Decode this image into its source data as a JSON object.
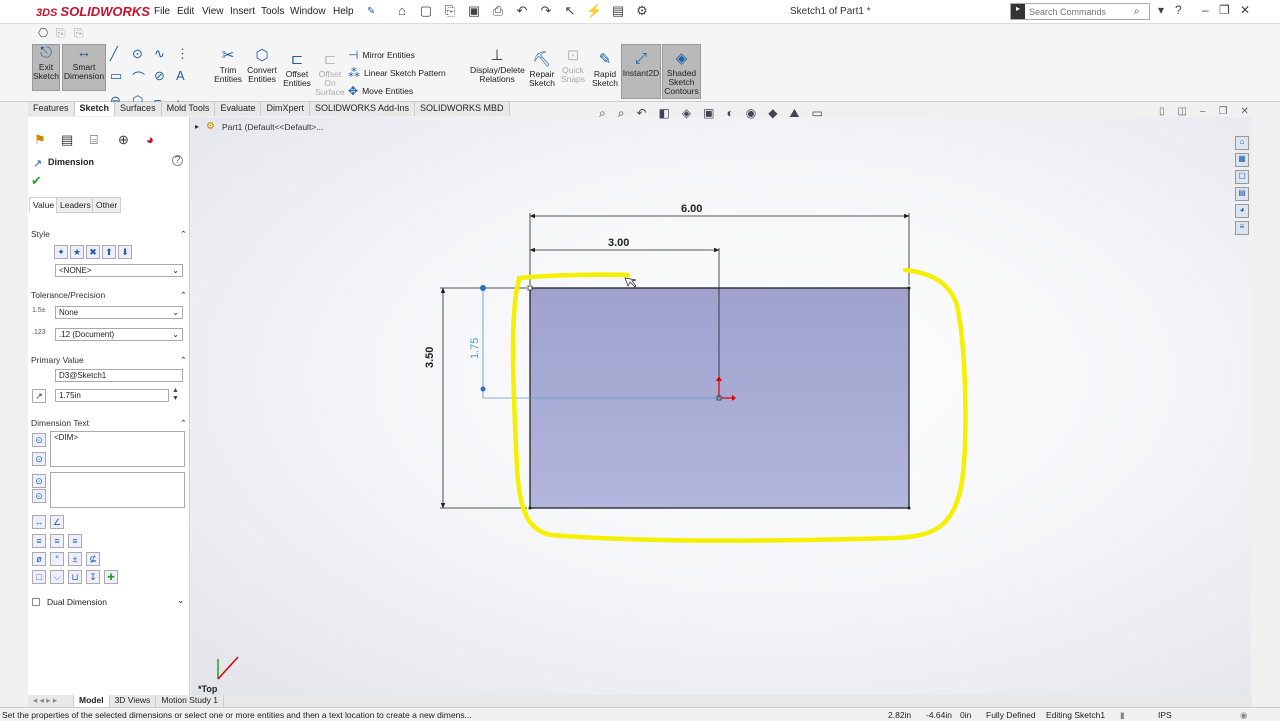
{
  "app": {
    "logo": "SOLIDWORKS",
    "doc_title": "Sketch1 of Part1 *"
  },
  "menu": [
    "File",
    "Edit",
    "View",
    "Insert",
    "Tools",
    "Window",
    "Help"
  ],
  "search": {
    "placeholder": "Search Commands"
  },
  "ribbon": {
    "exit_sketch": "Exit Sketch",
    "smart_dimension": "Smart Dimension",
    "trim": "Trim Entities",
    "convert": "Convert Entities",
    "offset": "Offset Entities",
    "offset_surface": "Offset On Surface",
    "mirror": "Mirror Entities",
    "linear_pattern": "Linear Sketch Pattern",
    "move": "Move Entities",
    "display_delete": "Display/Delete Relations",
    "repair": "Repair Sketch",
    "quick_snaps": "Quick Snaps",
    "rapid": "Rapid Sketch",
    "instant2d": "Instant2D",
    "shaded": "Shaded Sketch Contours"
  },
  "tabs": [
    "Features",
    "Sketch",
    "Surfaces",
    "Mold Tools",
    "Evaluate",
    "DimXpert",
    "SOLIDWORKS Add-Ins",
    "SOLIDWORKS MBD"
  ],
  "active_tab": "Sketch",
  "panel": {
    "title": "Dimension",
    "subtabs": [
      "Value",
      "Leaders",
      "Other"
    ],
    "style_label": "Style",
    "style_value": "<NONE>",
    "tolerance_label": "Tolerance/Precision",
    "tolerance_value": "None",
    "precision_value": ".12 (Document)",
    "primary_label": "Primary Value",
    "primary_name": "D3@Sketch1",
    "primary_value": "1.75in",
    "dimtext_label": "Dimension Text",
    "dimtext_value": "<DIM>",
    "dual_label": "Dual Dimension"
  },
  "tree": {
    "root": "Part1  (Default<<Default>..."
  },
  "sketch": {
    "dim_top": "6.00",
    "dim_mid": "3.00",
    "dim_left": "3.50",
    "dim_active": "1.75",
    "view_label": "*Top"
  },
  "colors": {
    "rect_fill": "#a3a6cf",
    "highlight": "#f5f000",
    "active_dim": "#5b9bd5",
    "brand": "#c8102e"
  },
  "bottom_tabs": [
    "Model",
    "3D Views",
    "Motion Study 1"
  ],
  "status": {
    "message": "Set the properties of the selected dimensions or select one or more entities and then a text location to create a new dimens...",
    "x": "2.82in",
    "y": "-4.64in",
    "z": "0in",
    "state": "Fully Defined",
    "mode": "Editing Sketch1",
    "units": "IPS"
  }
}
